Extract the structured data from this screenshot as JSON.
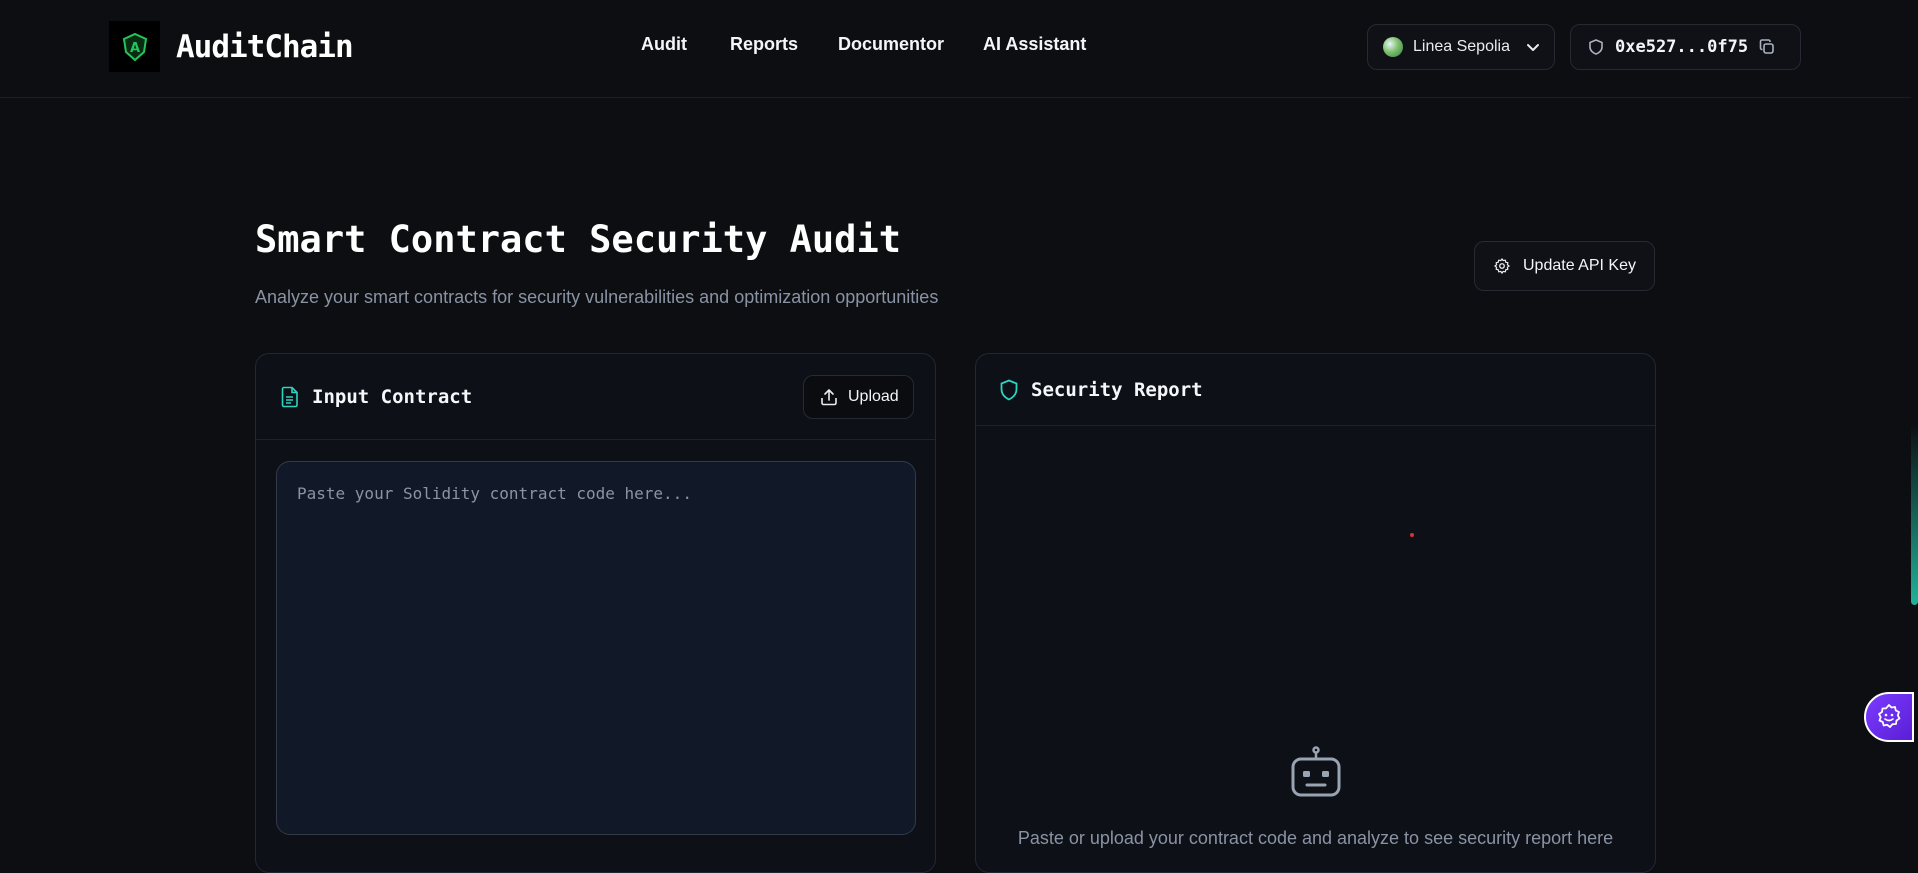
{
  "header": {
    "brand": "AuditChain",
    "logo_letter": "A",
    "nav": [
      "Audit",
      "Reports",
      "Documentor",
      "AI Assistant"
    ],
    "network": "Linea Sepolia",
    "wallet_address": "0xe527...0f75"
  },
  "main": {
    "title": "Smart Contract Security Audit",
    "subtitle": "Analyze your smart contracts for security vulnerabilities and optimization opportunities",
    "api_button": "Update API Key",
    "input_panel": {
      "title": "Input Contract",
      "upload_button": "Upload",
      "placeholder": "Paste your Solidity contract code here..."
    },
    "report_panel": {
      "title": "Security Report",
      "empty_message": "Paste or upload your contract code and analyze to see security report here"
    }
  },
  "colors": {
    "background": "#0c0e12",
    "accent_green": "#22c55e",
    "accent_teal": "#2dd4bf",
    "floating_purple": "#6d28d9"
  },
  "icons": [
    "shield-logo-icon",
    "network-globe-icon",
    "chevron-down-icon",
    "shield-icon",
    "copy-icon",
    "gear-icon",
    "document-icon",
    "upload-icon",
    "shield-outline-icon",
    "robot-icon",
    "settings-badge-icon"
  ]
}
